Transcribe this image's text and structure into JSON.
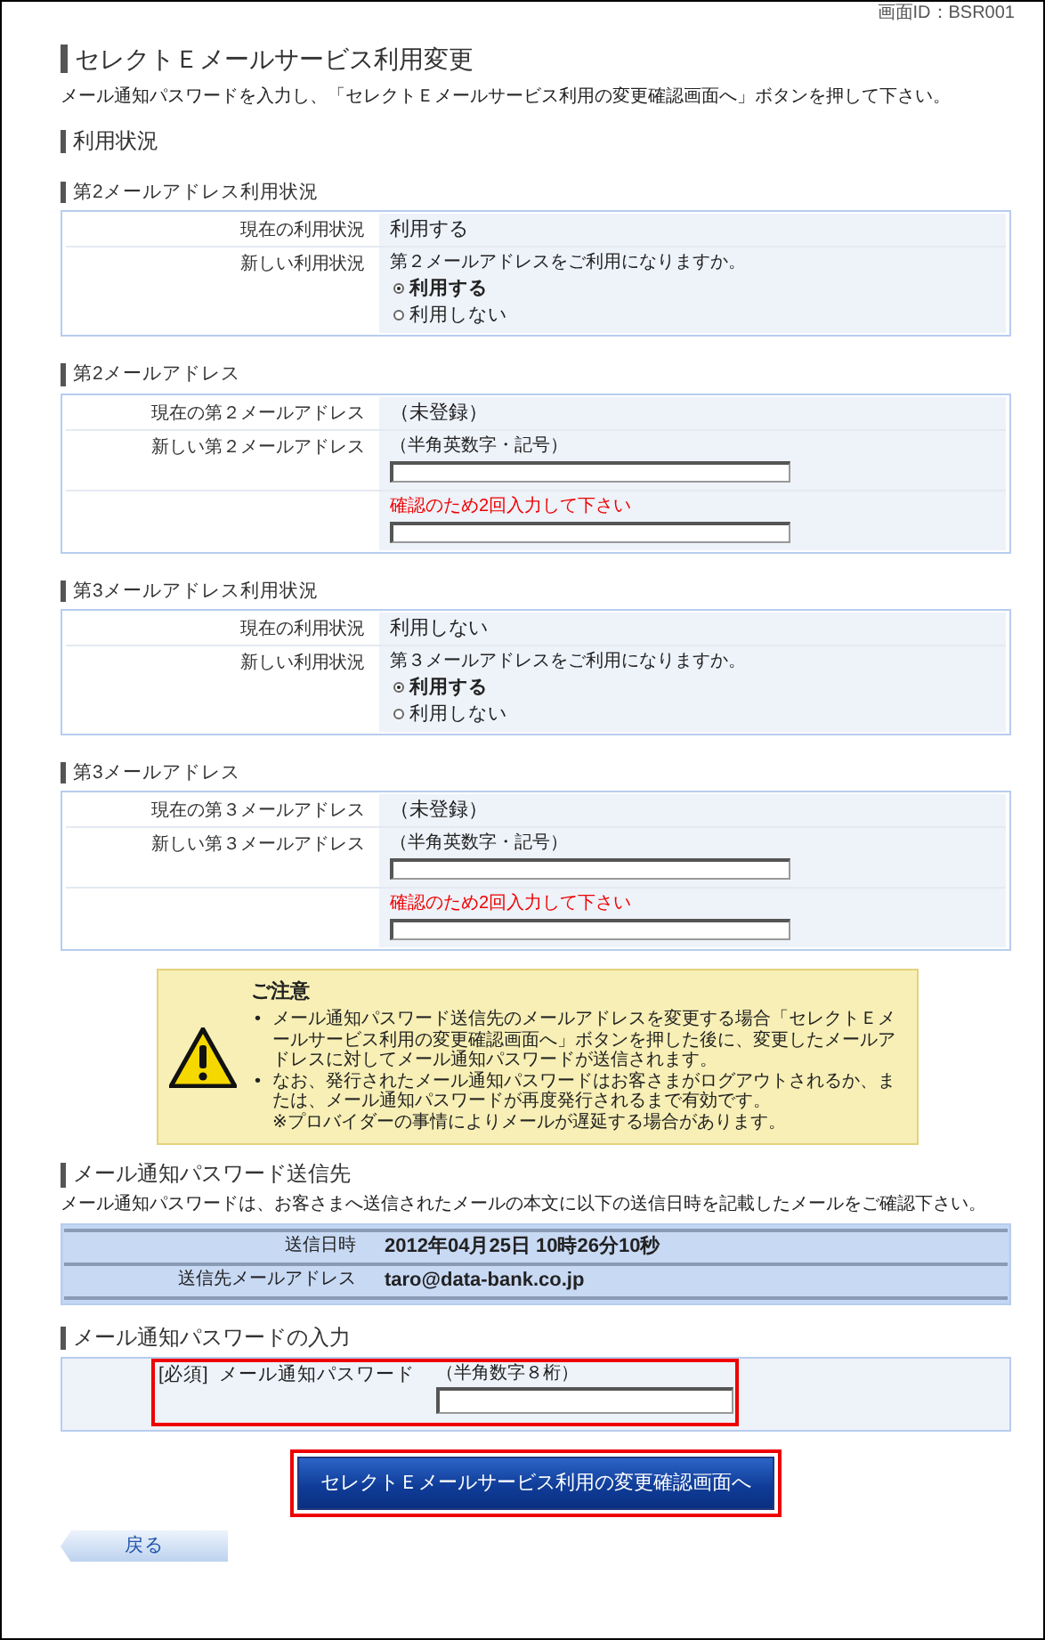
{
  "screen_id": "画面ID：BSR001",
  "title": "セレクトＥメールサービス利用変更",
  "instruction": "メール通知パスワードを入力し、「セレクトＥメールサービス利用の変更確認画面へ」ボタンを押して下さい。",
  "section_heading": "利用状況",
  "panels": [
    {
      "heading": "第2メールアドレス利用状況",
      "rows": [
        {
          "kind": "text",
          "label": "現在の利用状況",
          "value": "利用する"
        },
        {
          "kind": "radio",
          "label": "新しい利用状況",
          "question": "第２メールアドレスをご利用になりますか。",
          "options": [
            {
              "label": "利用する",
              "selected": true
            },
            {
              "label": "利用しない",
              "selected": false
            }
          ]
        }
      ]
    },
    {
      "heading": "第2メールアドレス",
      "rows": [
        {
          "kind": "text",
          "label": "現在の第２メールアドレス",
          "value": "（未登録）"
        },
        {
          "kind": "input",
          "label": "新しい第２メールアドレス",
          "hint": "（半角英数字・記号）"
        },
        {
          "kind": "input",
          "note": "確認のため2回入力して下さい"
        }
      ]
    },
    {
      "heading": "第3メールアドレス利用状況",
      "rows": [
        {
          "kind": "text",
          "label": "現在の利用状況",
          "value": "利用しない"
        },
        {
          "kind": "radio",
          "label": "新しい利用状況",
          "question": "第３メールアドレスをご利用になりますか。",
          "options": [
            {
              "label": "利用する",
              "selected": true
            },
            {
              "label": "利用しない",
              "selected": false
            }
          ]
        }
      ]
    },
    {
      "heading": "第3メールアドレス",
      "rows": [
        {
          "kind": "text",
          "label": "現在の第３メールアドレス",
          "value": "（未登録）"
        },
        {
          "kind": "input",
          "label": "新しい第３メールアドレス",
          "hint": "（半角英数字・記号）"
        },
        {
          "kind": "input",
          "note": "確認のため2回入力して下さい"
        }
      ]
    }
  ],
  "notice": {
    "title": "ご注意",
    "items": [
      {
        "marker": "•",
        "text": "メール通知パスワード送信先のメールアドレスを変更する場合「セレクトＥメールサービス利用の変更確認画面へ」ボタンを押した後に、変更したメールアドレスに対してメール通知パスワードが送信されます。"
      },
      {
        "marker": "•",
        "text": "なお、発行されたメール通知パスワードはお客さまがログアウトされるか、または、メール通知パスワードが再度発行されるまで有効です。",
        "note": "※プロバイダーの事情によりメールが遅延する場合があります。"
      }
    ]
  },
  "send_section": {
    "heading": "メール通知パスワード送信先",
    "text": "メール通知パスワードは、お客さまへ送信されたメールの本文に以下の送信日時を記載したメールをご確認下さい。",
    "rows": [
      {
        "label": "送信日時",
        "value": "2012年04月25日 10時26分10秒"
      },
      {
        "label": "送信先メールアドレス",
        "value": "taro@data-bank.co.jp"
      }
    ]
  },
  "password_section": {
    "heading": "メール通知パスワードの入力",
    "required_tag": "[必須]",
    "label": "メール通知パスワード",
    "hint": "（半角数字８桁）",
    "highlighted": true
  },
  "submit_button": {
    "label": "セレクトＥメールサービス利用の変更確認画面へ",
    "highlighted": true
  },
  "back_button": {
    "label": "戻る"
  }
}
